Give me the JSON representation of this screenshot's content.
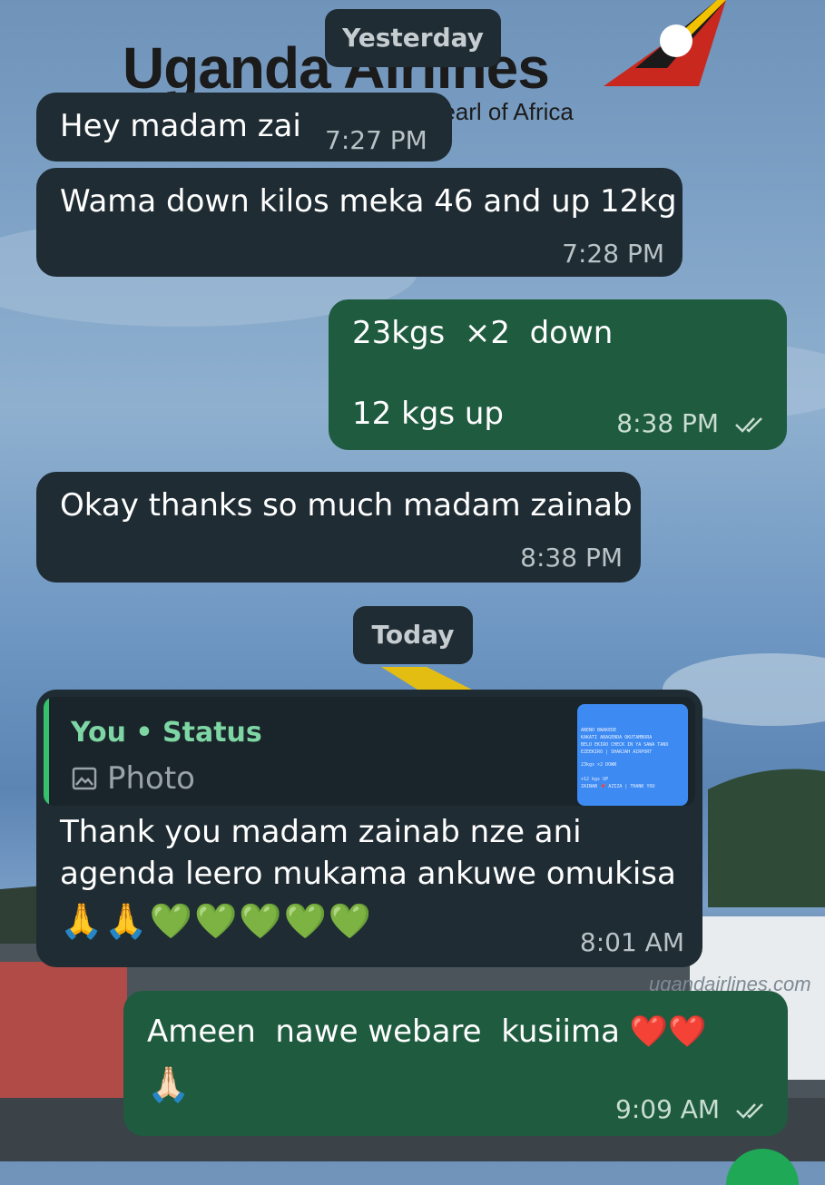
{
  "wallpaper": {
    "brand_text": "Uganda Airlines",
    "tagline": "Pearl of Africa",
    "website": "ugandairlines.com"
  },
  "dates": {
    "yesterday": "Yesterday",
    "today": "Today"
  },
  "messages": [
    {
      "direction": "incoming",
      "text": "Hey madam zai",
      "time": "7:27 PM"
    },
    {
      "direction": "incoming",
      "text": "Wama down kilos meka 46 and up 12kg",
      "time": "7:28 PM"
    },
    {
      "direction": "outgoing",
      "lines": [
        "23kgs  ×2  down",
        "12 kgs up"
      ],
      "time": "8:38 PM",
      "status": "read"
    },
    {
      "direction": "incoming",
      "text": "Okay thanks so much madam zainab",
      "time": "8:38 PM"
    },
    {
      "direction": "incoming",
      "reply": {
        "author": "You • Status",
        "type": "Photo",
        "thumbnail_lines": [
          "ABENO BWAKEDE",
          "KAKATI ABAGENDA OKUTAMBURA",
          "BELO EKIRO CHECK IN YA SAWA TANO",
          "EZEEKIRO | SHARJAH AIRPORT",
          "",
          "23kgs ×2 DOWN",
          "",
          "+12 kgs UP",
          "ZAINAB 📌 AZIZA | THANK YOU"
        ]
      },
      "lines": [
        "Thank you madam zainab nze ani",
        "agenda leero mukama ankuwe omukisa"
      ],
      "emojis": "🙏🙏💚💚💚💚💚",
      "time": "8:01 AM"
    },
    {
      "direction": "outgoing",
      "text": "Ameen  nawe webare  kusiima ❤️❤️",
      "emojis": "🙏🏻",
      "time": "9:09 AM",
      "status": "read"
    }
  ],
  "colors": {
    "incoming_bubble": "#1f2c33",
    "outgoing_bubble": "#1f5b3f",
    "reply_accent": "#37c36c"
  }
}
